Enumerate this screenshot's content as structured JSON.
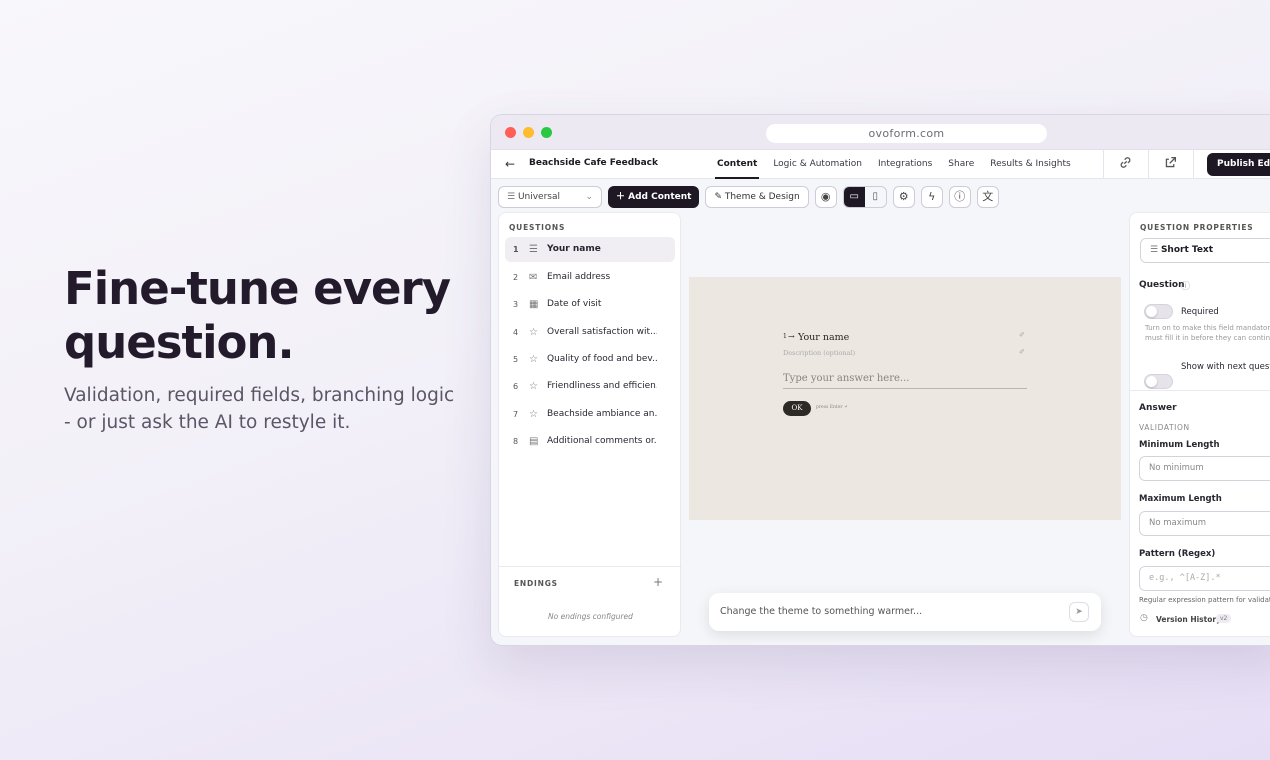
{
  "hero": {
    "headline": "Fine-tune every question.",
    "subtext": "Validation, required fields, branching logic - or just ask the AI to restyle it."
  },
  "browser": {
    "url": "ovoform.com"
  },
  "nav": {
    "back_icon": "←",
    "form_title": "Beachside Cafe Feedback",
    "tabs": [
      "Content",
      "Logic & Automation",
      "Integrations",
      "Share",
      "Results & Insights"
    ],
    "active_tab": "Content",
    "publish_label": "Publish Edits"
  },
  "toolbar": {
    "mode_value": "Universal",
    "add_content_label": "Add Content",
    "theme_label": "Theme & Design",
    "icons": [
      "eye-icon",
      "desktop-icon",
      "mobile-icon",
      "settings-icon",
      "bolt-icon",
      "accessibility-icon",
      "translate-icon"
    ]
  },
  "questions_panel": {
    "heading": "QUESTIONS",
    "items": [
      {
        "num": "1",
        "label": "Your name",
        "icon": "short-text-icon"
      },
      {
        "num": "2",
        "label": "Email address",
        "icon": "mail-icon"
      },
      {
        "num": "3",
        "label": "Date of visit",
        "icon": "calendar-icon"
      },
      {
        "num": "4",
        "label": "Overall satisfaction wit...",
        "icon": "star-icon"
      },
      {
        "num": "5",
        "label": "Quality of food and bev...",
        "icon": "star-icon"
      },
      {
        "num": "6",
        "label": "Friendliness and efficien...",
        "icon": "star-icon"
      },
      {
        "num": "7",
        "label": "Beachside ambiance an...",
        "icon": "star-icon"
      },
      {
        "num": "8",
        "label": "Additional comments or...",
        "icon": "document-icon"
      }
    ],
    "endings_heading": "ENDINGS",
    "endings_empty": "No endings configured"
  },
  "preview": {
    "q_number": "1",
    "q_title": "Your name",
    "q_description": "Description (optional)",
    "placeholder": "Type your answer here...",
    "ok_label": "OK",
    "enter_hint": "press Enter ↵"
  },
  "chat": {
    "placeholder": "Change the theme to something warmer..."
  },
  "properties": {
    "heading": "QUESTION PROPERTIES",
    "type_value": "Short Text",
    "question_section": "Question",
    "required_label": "Required",
    "required_hint": "Turn on to make this field mandatory. must fill it in before they can continue",
    "show_next_label": "Show with next questio",
    "answer_section": "Answer",
    "validation_heading": "VALIDATION",
    "min_label": "Minimum Length",
    "min_placeholder": "No minimum",
    "max_label": "Maximum Length",
    "max_placeholder": "No maximum",
    "pattern_label": "Pattern (Regex)",
    "pattern_placeholder": "e.g., ^[A-Z].*",
    "pattern_hint": "Regular expression pattern for validati",
    "version_label": "Version History",
    "version_badge": "v2"
  },
  "colors": {
    "accent_dark": "#1e1824",
    "canvas_bg": "#ece7e1",
    "traffic_red": "#ff5f57",
    "traffic_yellow": "#febc2e",
    "traffic_green": "#28c840"
  }
}
